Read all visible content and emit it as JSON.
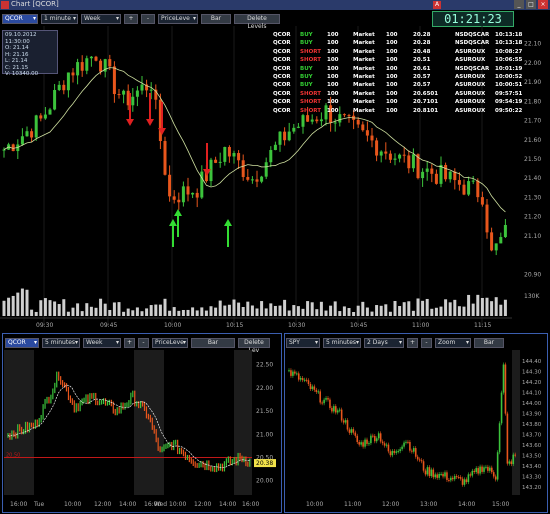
{
  "window": {
    "title": "Chart [QCOR]"
  },
  "clock": "01:21:23",
  "main_toolbar": {
    "symbol": "QCOR",
    "interval": "1 minute",
    "range": "Week",
    "plus": "+",
    "minus": "-",
    "levels": "PriceLeve",
    "style": "Bar",
    "delete_levels": "Delete Levels"
  },
  "ohlc": {
    "date": "09.10.2012 11:30:00",
    "o": "O: 21.14",
    "h": "H: 21.16",
    "l": "L: 21.14",
    "c": "C: 21.15",
    "v": "V: 10340.00"
  },
  "trades": [
    {
      "sym": "QCOR",
      "side": "BUY",
      "qty": "100",
      "type": "Market",
      "q2": "100",
      "price": "20.28",
      "route": "NSDQSCAR",
      "time": "10:13:18"
    },
    {
      "sym": "QCOR",
      "side": "BUY",
      "qty": "100",
      "type": "Market",
      "q2": "100",
      "price": "20.28",
      "route": "NSDQSCAR",
      "time": "10:13:18"
    },
    {
      "sym": "QCOR",
      "side": "SHORT",
      "qty": "100",
      "type": "Market",
      "q2": "100",
      "price": "20.48",
      "route": "ASUROUX",
      "time": "10:08:27"
    },
    {
      "sym": "QCOR",
      "side": "SHORT",
      "qty": "100",
      "type": "Market",
      "q2": "100",
      "price": "20.51",
      "route": "ASUROUX",
      "time": "10:06:55"
    },
    {
      "sym": "QCOR",
      "side": "BUY",
      "qty": "100",
      "type": "Market",
      "q2": "100",
      "price": "20.61",
      "route": "NSDQSCAR",
      "time": "10:01:19"
    },
    {
      "sym": "QCOR",
      "side": "BUY",
      "qty": "100",
      "type": "Market",
      "q2": "100",
      "price": "20.57",
      "route": "ASUROUX",
      "time": "10:00:52"
    },
    {
      "sym": "QCOR",
      "side": "BUY",
      "qty": "100",
      "type": "Market",
      "q2": "100",
      "price": "20.57",
      "route": "ASUROUX",
      "time": "10:00:51"
    },
    {
      "sym": "QCOR",
      "side": "SHORT",
      "qty": "100",
      "type": "Market",
      "q2": "100",
      "price": "20.6501",
      "route": "ASUROUX",
      "time": "09:57:51"
    },
    {
      "sym": "QCOR",
      "side": "SHORT",
      "qty": "100",
      "type": "Market",
      "q2": "100",
      "price": "20.7101",
      "route": "ASUROUX",
      "time": "09:54:19"
    },
    {
      "sym": "QCOR",
      "side": "SHORT",
      "qty": "100",
      "type": "Market",
      "q2": "100",
      "price": "20.8101",
      "route": "ASUROUX",
      "time": "09:50:22"
    }
  ],
  "main_yaxis": [
    "22.10",
    "22.00",
    "21.90",
    "21.80",
    "21.70",
    "21.60",
    "21.50",
    "21.40",
    "21.30",
    "21.20",
    "21.10",
    "20.90"
  ],
  "main_xaxis": [
    "09:30",
    "09:45",
    "10:00",
    "10:15",
    "10:30",
    "10:45",
    "11:00",
    "11:15"
  ],
  "volume_label": "130K",
  "bl_toolbar": {
    "symbol": "QCOR",
    "interval": "5 minutes",
    "range": "Week",
    "plus": "+",
    "minus": "-",
    "levels": "PriceLeve",
    "style": "Bar",
    "delete_levels": "Delete Lev"
  },
  "bl_yaxis": [
    "22.50",
    "22.00",
    "21.50",
    "21.00",
    "20.50",
    "20.00"
  ],
  "bl_price_tag": "20.38",
  "bl_level_tag": "20.50",
  "bl_xaxis": [
    "16:00",
    "Tue",
    "10:00",
    "12:00",
    "14:00",
    "16:00",
    "Wed",
    "10:00",
    "12:00",
    "14:00",
    "16:00"
  ],
  "br_toolbar": {
    "symbol": "SPY",
    "interval": "5 minutes",
    "range": "2 Days",
    "plus": "+",
    "minus": "-",
    "zoom": "Zoom",
    "style": "Bar"
  },
  "br_yaxis": [
    "144.40",
    "144.30",
    "144.20",
    "144.10",
    "144.00",
    "143.90",
    "143.80",
    "143.70",
    "143.60",
    "143.50",
    "143.40",
    "143.30",
    "143.20"
  ],
  "br_xaxis": [
    "10:00",
    "11:00",
    "12:00",
    "13:00",
    "14:00",
    "15:00"
  ],
  "colors": {
    "up": "#3cc33c",
    "down": "#e8561c",
    "ma": "#cfe0a0",
    "buy_arrow": "#33dd33",
    "short_arrow": "#e02020",
    "level": "#c01818"
  }
}
